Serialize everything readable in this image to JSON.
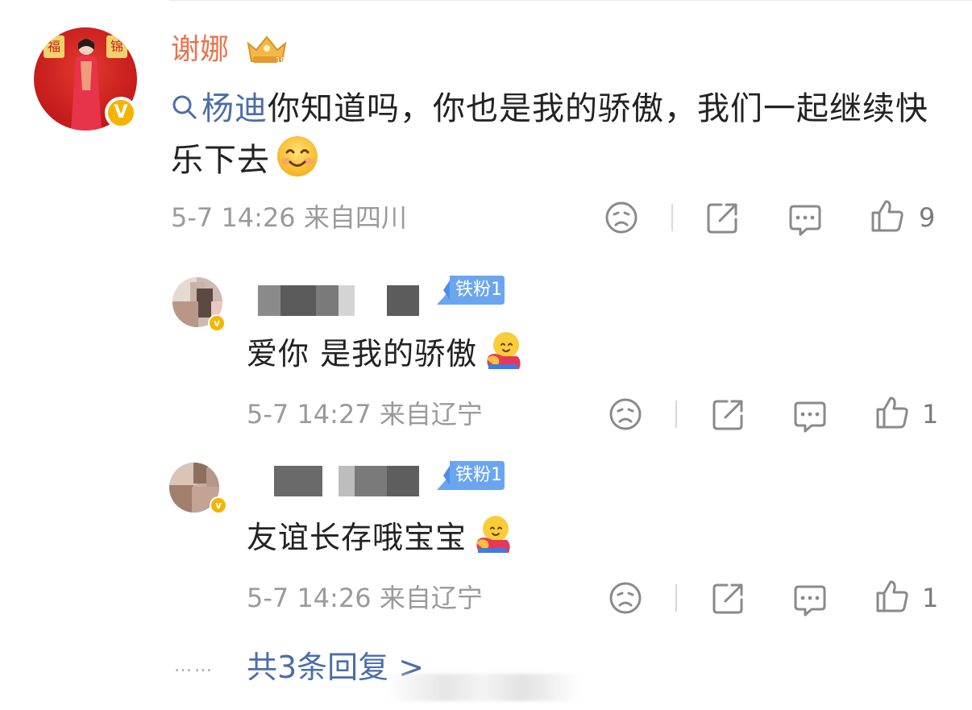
{
  "main_comment": {
    "username": "谢娜",
    "mention": "杨迪",
    "text": "你知道吗，你也是我的骄傲，我们一起继续快乐下去",
    "timestamp": "5-7 14:26",
    "location": "来自四川",
    "likes": "9",
    "avatar_tag_left": "福",
    "avatar_tag_right": "锦"
  },
  "replies": [
    {
      "badge": "铁粉1",
      "text": "爱你 是我的骄傲",
      "timestamp": "5-7 14:27",
      "location": "来自辽宁",
      "likes": "1"
    },
    {
      "badge": "铁粉1",
      "text": "友谊长存哦宝宝",
      "timestamp": "5-7 14:26",
      "location": "来自辽宁",
      "likes": "1"
    }
  ],
  "footer": {
    "dots": "……",
    "more_replies": "共3条回复 >"
  },
  "colors": {
    "username": "#eb7350",
    "link": "#4b6ea8",
    "meta": "#9a9a9a",
    "badge": "#6aa6f0",
    "verify": "#f6b400"
  },
  "icons": [
    "search-icon",
    "crown-vip-icon",
    "smile-emoji-icon",
    "sad-face-icon",
    "share-icon",
    "comment-icon",
    "thumbs-up-icon",
    "hug-emoji-icon",
    "verified-icon"
  ]
}
